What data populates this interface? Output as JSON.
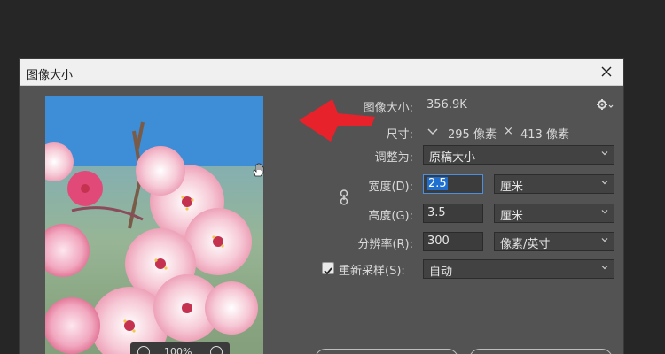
{
  "dialog": {
    "title": "图像大小"
  },
  "info": {
    "image_size_label": "图像大小:",
    "image_size_value": "356.9K",
    "dimensions_label": "尺寸:",
    "width_px": "295 像素",
    "times": "×",
    "height_px": "413 像素"
  },
  "fit": {
    "label": "调整为:",
    "value": "原稿大小"
  },
  "width": {
    "label": "宽度(D):",
    "value": "2.5",
    "unit": "厘米"
  },
  "height": {
    "label": "高度(G):",
    "value": "3.5",
    "unit": "厘米"
  },
  "resolution": {
    "label": "分辨率(R):",
    "value": "300",
    "unit": "像素/英寸"
  },
  "resample": {
    "label": "重新采样(S):",
    "checked": true,
    "value": "自动"
  },
  "preview": {
    "zoom": "100%"
  },
  "colors": {
    "arrow": "#e8222a",
    "dialog_bg": "#535353",
    "selection": "#1f6fd0"
  }
}
